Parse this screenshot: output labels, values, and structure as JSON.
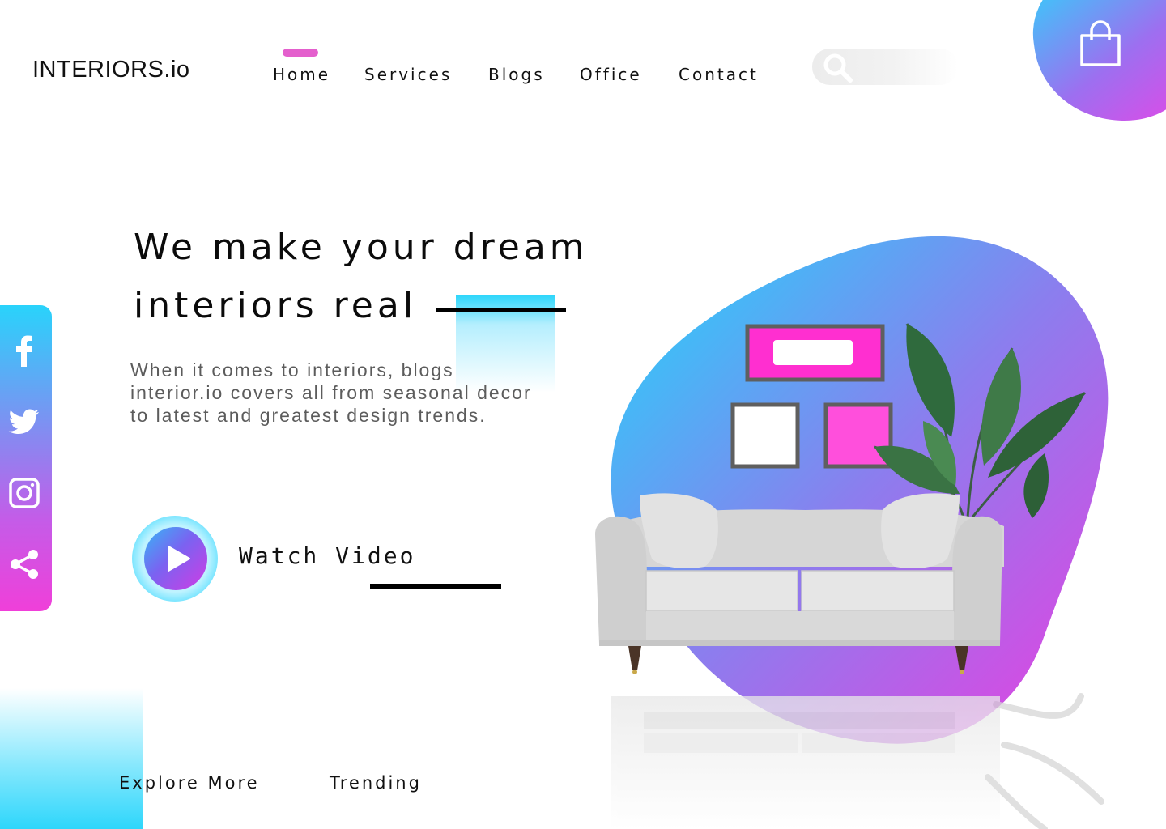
{
  "header": {
    "logo": "INTERIORS.io",
    "nav": [
      {
        "label": "Home",
        "active": true
      },
      {
        "label": "Services"
      },
      {
        "label": "Blogs"
      },
      {
        "label": "Office"
      },
      {
        "label": "Contact"
      }
    ],
    "search_icon": "search-icon",
    "cart_icon": "shopping-bag-icon"
  },
  "hero": {
    "headline_line1": "We make your dream",
    "headline_line2": "interiors real",
    "description_lines": [
      "When it comes to interiors, blogs",
      "interior.io covers all from seasonal decor",
      "to latest and greatest design trends."
    ],
    "watch_video_label": "Watch Video"
  },
  "social": [
    {
      "icon": "facebook-icon"
    },
    {
      "icon": "twitter-icon"
    },
    {
      "icon": "instagram-icon"
    },
    {
      "icon": "share-icon"
    }
  ],
  "footer_links": [
    {
      "label": "Explore More"
    },
    {
      "label": "Trending"
    }
  ],
  "colors": {
    "accent_pink": "#e45fcd",
    "gradient_cyan": "#2ed6fb",
    "gradient_purple": "#9d6ff0",
    "gradient_magenta": "#e646e6",
    "frame_pink": "#ff2fd0"
  }
}
